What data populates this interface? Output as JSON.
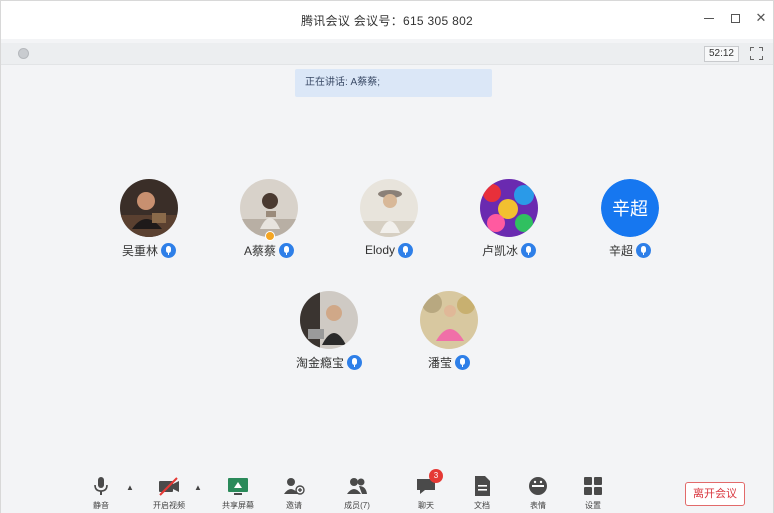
{
  "window": {
    "title": "腾讯会议 会议号：615 305 802"
  },
  "infobar": {
    "timer": "52:12"
  },
  "speaking": {
    "text": "正在讲话: A蔡蔡;"
  },
  "participants": [
    {
      "name": "吴重林",
      "avatar": "photo-man-dark"
    },
    {
      "name": "A蔡蔡",
      "avatar": "photo-girl-sitting",
      "host": true
    },
    {
      "name": "Elody",
      "avatar": "photo-woman-hat"
    },
    {
      "name": "卢凯冰",
      "avatar": "photo-colorful-crowd"
    },
    {
      "name": "辛超",
      "avatar_text": "辛超"
    },
    {
      "name": "淘金瘾宝",
      "avatar": "photo-man-office"
    },
    {
      "name": "潘莹",
      "avatar": "photo-dancer-pink"
    }
  ],
  "toolbar": {
    "mute": "静音",
    "video": "开启视频",
    "share": "共享屏幕",
    "invite": "邀请",
    "members": "成员(7)",
    "chat": "聊天",
    "chat_badge": "3",
    "docs": "文档",
    "emoji": "表情",
    "settings": "设置",
    "leave": "离开会议"
  },
  "colors": {
    "accent": "#1677f0",
    "danger": "#d9363e",
    "speaking_bg": "#dbe7f7"
  }
}
